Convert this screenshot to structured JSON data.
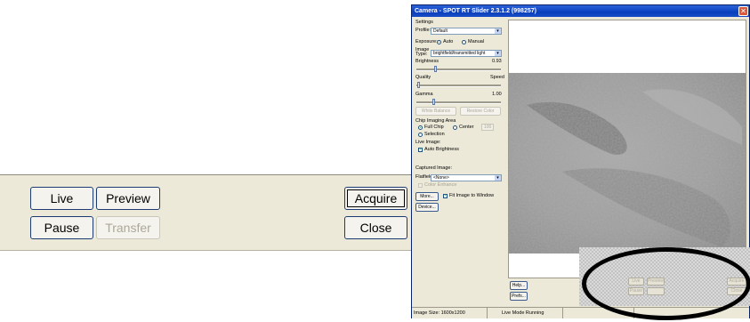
{
  "zoom": {
    "live": "Live",
    "preview": "Preview",
    "acquire": "Acquire",
    "pause": "Pause",
    "transfer": "Transfer",
    "close": "Close"
  },
  "window": {
    "title": "Camera - SPOT RT Slider 2.3.1.2  (998257)",
    "settings_label": "Settings",
    "profile_label": "Profile:",
    "profile_value": "Default",
    "exposure_label": "Exposure:",
    "exposure_auto": "Auto",
    "exposure_manual": "Manual",
    "image_type_label": "Image Type:",
    "image_type_value": "brightfield/transmitted light",
    "brightness_label": "Brightness",
    "brightness_value": "0.93",
    "quality_label": "Quality",
    "speed_label": "Speed",
    "gamma_label": "Gamma",
    "gamma_value": "1.00",
    "white_balance": "White Balance",
    "restore_color": "Restore Color",
    "chip_area_label": "Chip Imaging Area",
    "full_chip": "Full Chip",
    "center": "Center",
    "center_value": "100",
    "selection": "Selection",
    "live_image_label": "Live Image:",
    "auto_brightness": "Auto Brightness",
    "captured_image_label": "Captured Image:",
    "flatfield_label": "Flatfield:",
    "flatfield_value": "<None>",
    "color_enhance": "Color Enhance",
    "more_btn": "More...",
    "fit_image": "Fit Image to Window",
    "device_btn": "Device...",
    "help_btn": "Help...",
    "prefs_btn": "Prefs...",
    "ghost_live": "Live",
    "ghost_preview": "Preview",
    "ghost_acquire": "Acquire",
    "ghost_pause": "Pause",
    "ghost_close": "Close",
    "status_size": "Image Size: 1600x1200",
    "status_mode": "Live Mode Running"
  },
  "colors": {
    "title_bar": "#0a3fbd",
    "window_bg": "#ece9d8",
    "highlight_ellipse": "#000000"
  },
  "icons": {
    "close": "close-icon"
  }
}
